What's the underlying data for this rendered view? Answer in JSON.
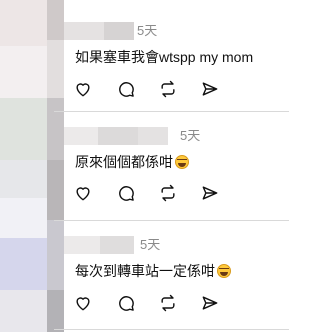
{
  "replies": [
    {
      "time": "5天",
      "text": "如果塞車我會wtspp my mom",
      "emoji": ""
    },
    {
      "time": "5天",
      "text": "原來個個都係咁",
      "emoji": "grinning-sweat-emoji"
    },
    {
      "time": "5天",
      "text": "每次到轉車站一定係咁",
      "emoji": "grinning-sweat-emoji"
    }
  ],
  "icons": {
    "like": "heart-icon",
    "comment": "comment-icon",
    "repost": "repost-icon",
    "share": "send-icon"
  }
}
